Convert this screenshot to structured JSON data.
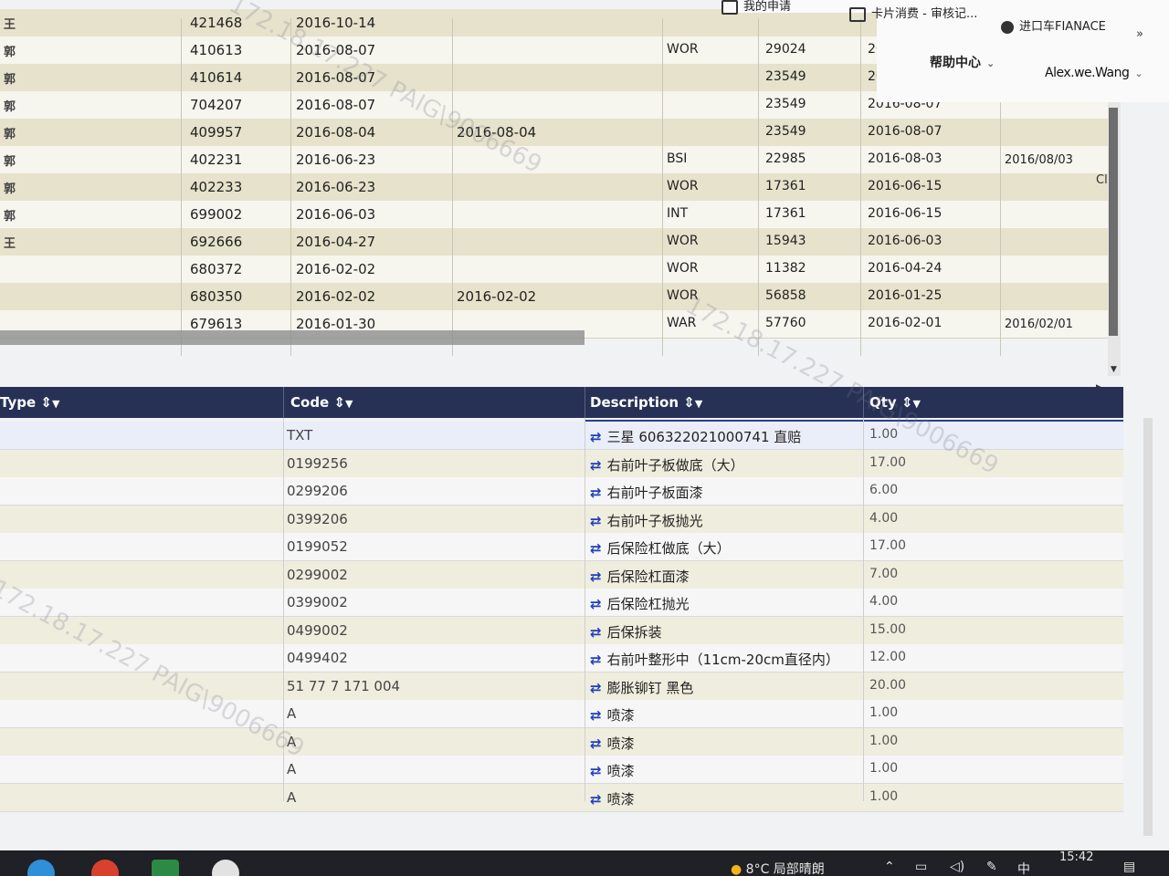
{
  "topbar": {
    "tabs": [
      {
        "label": "我的申请"
      },
      {
        "label": "卡片消费 - 审核记..."
      },
      {
        "label": "进口车FIANACE"
      }
    ],
    "more": "»",
    "help_label": "帮助中心",
    "user_name": "Alex.we.Wang",
    "watermark": "172.18.17.227 PAIG\\9006669"
  },
  "upper_table": {
    "rows": [
      {
        "c0": "王",
        "c1": "421468",
        "c2": "2016-10-14",
        "c3": "",
        "c4": "",
        "c5": "",
        "c6": "",
        "c7": ""
      },
      {
        "c0": "郭",
        "c1": "410613",
        "c2": "2016-08-07",
        "c3": "",
        "c4": "WOR",
        "c5": "29024",
        "c6": "2016-09-28",
        "c7": ""
      },
      {
        "c0": "郭",
        "c1": "410614",
        "c2": "2016-08-07",
        "c3": "",
        "c4": "",
        "c5": "23549",
        "c6": "2016-08-07",
        "c7": ""
      },
      {
        "c0": "郭",
        "c1": "704207",
        "c2": "2016-08-07",
        "c3": "",
        "c4": "",
        "c5": "23549",
        "c6": "2016-08-07",
        "c7": ""
      },
      {
        "c0": "郭",
        "c1": "409957",
        "c2": "2016-08-04",
        "c3": "2016-08-04",
        "c4": "",
        "c5": "23549",
        "c6": "2016-08-07",
        "c7": ""
      },
      {
        "c0": "郭",
        "c1": "402231",
        "c2": "2016-06-23",
        "c3": "",
        "c4": "BSI",
        "c5": "22985",
        "c6": "2016-08-03",
        "c7": "2016/08/03"
      },
      {
        "c0": "郭",
        "c1": "402233",
        "c2": "2016-06-23",
        "c3": "",
        "c4": "WOR",
        "c5": "17361",
        "c6": "2016-06-15",
        "c7": ""
      },
      {
        "c0": "郭",
        "c1": "699002",
        "c2": "2016-06-03",
        "c3": "",
        "c4": "INT",
        "c5": "17361",
        "c6": "2016-06-15",
        "c7": ""
      },
      {
        "c0": "王",
        "c1": "692666",
        "c2": "2016-04-27",
        "c3": "",
        "c4": "WOR",
        "c5": "15943",
        "c6": "2016-06-03",
        "c7": ""
      },
      {
        "c0": "",
        "c1": "680372",
        "c2": "2016-02-02",
        "c3": "",
        "c4": "WOR",
        "c5": "11382",
        "c6": "2016-04-24",
        "c7": ""
      },
      {
        "c0": "",
        "c1": "680350",
        "c2": "2016-02-02",
        "c3": "2016-02-02",
        "c4": "WOR",
        "c5": "56858",
        "c6": "2016-01-25",
        "c7": ""
      },
      {
        "c0": "",
        "c1": "679613",
        "c2": "2016-01-30",
        "c3": "",
        "c4": "WAR",
        "c5": "57760",
        "c6": "2016-02-01",
        "c7": "2016/02/01"
      }
    ],
    "edge_text": "Cl"
  },
  "lower_table": {
    "headers": {
      "type": "Type",
      "code": "Code",
      "description": "Description",
      "qty": "Qty"
    },
    "sort_icon": "⇕",
    "filter_icon": "▼",
    "rows": [
      {
        "code": "TXT",
        "description": "三星 606322021000741 直赔",
        "qty": "1.00"
      },
      {
        "code": "0199256",
        "description": "右前叶子板做底（大）",
        "qty": "17.00"
      },
      {
        "code": "0299206",
        "description": "右前叶子板面漆",
        "qty": "6.00"
      },
      {
        "code": "0399206",
        "description": "右前叶子板抛光",
        "qty": "4.00"
      },
      {
        "code": "0199052",
        "description": "后保险杠做底（大）",
        "qty": "17.00"
      },
      {
        "code": "0299002",
        "description": "后保险杠面漆",
        "qty": "7.00"
      },
      {
        "code": "0399002",
        "description": "后保险杠抛光",
        "qty": "4.00"
      },
      {
        "code": "0499002",
        "description": "后保拆装",
        "qty": "15.00"
      },
      {
        "code": "0499402",
        "description": "右前叶整形中（11cm-20cm直径内）",
        "qty": "12.00"
      },
      {
        "code": "51 77 7 171 004",
        "description": "膨胀铆钉 黑色",
        "qty": "20.00"
      },
      {
        "code": "A",
        "description": "喷漆",
        "qty": "1.00"
      },
      {
        "code": "A",
        "description": "喷漆",
        "qty": "1.00"
      },
      {
        "code": "A",
        "description": "喷漆",
        "qty": "1.00"
      },
      {
        "code": "A",
        "description": "喷漆",
        "qty": "1.00"
      }
    ]
  },
  "taskbar": {
    "weather": "8°C 局部晴朗",
    "ime": "中",
    "time": "15:42"
  }
}
